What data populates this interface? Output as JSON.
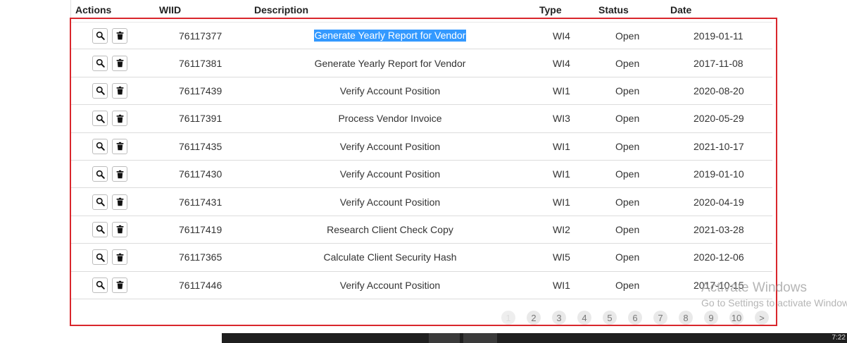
{
  "table": {
    "headers": {
      "actions": "Actions",
      "wiid": "WIID",
      "description": "Description",
      "type": "Type",
      "status": "Status",
      "date": "Date"
    },
    "rows": [
      {
        "wiid": "76117377",
        "description": "Generate Yearly Report for Vendor",
        "type": "WI4",
        "status": "Open",
        "date": "2019-01-11",
        "selected": true
      },
      {
        "wiid": "76117381",
        "description": "Generate Yearly Report for Vendor",
        "type": "WI4",
        "status": "Open",
        "date": "2017-11-08"
      },
      {
        "wiid": "76117439",
        "description": "Verify Account Position",
        "type": "WI1",
        "status": "Open",
        "date": "2020-08-20"
      },
      {
        "wiid": "76117391",
        "description": "Process Vendor Invoice",
        "type": "WI3",
        "status": "Open",
        "date": "2020-05-29"
      },
      {
        "wiid": "76117435",
        "description": "Verify Account Position",
        "type": "WI1",
        "status": "Open",
        "date": "2021-10-17"
      },
      {
        "wiid": "76117430",
        "description": "Verify Account Position",
        "type": "WI1",
        "status": "Open",
        "date": "2019-01-10"
      },
      {
        "wiid": "76117431",
        "description": "Verify Account Position",
        "type": "WI1",
        "status": "Open",
        "date": "2020-04-19"
      },
      {
        "wiid": "76117419",
        "description": "Research Client Check Copy",
        "type": "WI2",
        "status": "Open",
        "date": "2021-03-28"
      },
      {
        "wiid": "76117365",
        "description": "Calculate Client Security Hash",
        "type": "WI5",
        "status": "Open",
        "date": "2020-12-06"
      },
      {
        "wiid": "76117446",
        "description": "Verify Account Position",
        "type": "WI1",
        "status": "Open",
        "date": "2017-10-15"
      }
    ],
    "row_actions": {
      "view_icon": "search-icon",
      "delete_icon": "trash-icon"
    }
  },
  "pagination": {
    "pages": [
      "1",
      "2",
      "3",
      "4",
      "5",
      "6",
      "7",
      "8",
      "9",
      "10"
    ],
    "current": "1",
    "next_label": ">"
  },
  "watermark": {
    "title": "Activate Windows",
    "subtitle": "Go to Settings to activate Windows."
  },
  "taskbar": {
    "clock": "7:22"
  },
  "colors": {
    "highlight": "#d9262c",
    "selection": "#3399ff"
  }
}
